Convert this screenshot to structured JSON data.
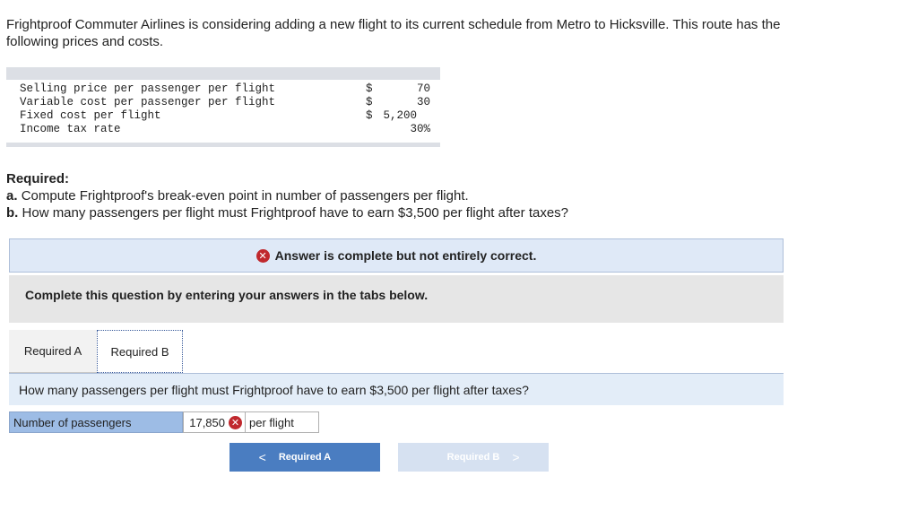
{
  "intro": {
    "line1": "Frightproof Commuter Airlines is considering adding a new flight to its current schedule from Metro to Hicksville. This route has the",
    "line2": "following prices and costs."
  },
  "data_table": [
    {
      "label": "Selling price per passenger per flight",
      "symbol": "$",
      "value": "70"
    },
    {
      "label": "Variable cost per passenger per flight",
      "symbol": "$",
      "value": "30"
    },
    {
      "label": "Fixed cost per flight",
      "symbol": "$",
      "value": "5,200"
    },
    {
      "label": "Income tax rate",
      "symbol": "",
      "value": "30%"
    }
  ],
  "required": {
    "heading": "Required:",
    "a_prefix": "a.",
    "a_text": "Compute Frightproof's break-even point in number of passengers per flight.",
    "b_prefix": "b.",
    "b_text": "How many passengers per flight must Frightproof have to earn $3,500 per flight after taxes?"
  },
  "feedback": {
    "icon": "x-circle-icon",
    "text": "Answer is complete but not entirely correct."
  },
  "instructions": "Complete this question by entering your answers in the tabs below.",
  "tabs": [
    {
      "label": "Required A"
    },
    {
      "label": "Required B"
    }
  ],
  "question": "How many passengers per flight must Frightproof have to earn $3,500 per flight after taxes?",
  "answer": {
    "label": "Number of passengers",
    "value": "17,850",
    "unit": "per flight",
    "status": "incorrect"
  },
  "nav": {
    "prev_label": "Required A",
    "next_label": "Required B",
    "prev_glyph": "<",
    "next_glyph": ">"
  },
  "colors": {
    "accent": "#4a7dc1",
    "error": "#c0282d",
    "feedback_bg": "#dfe9f7"
  }
}
